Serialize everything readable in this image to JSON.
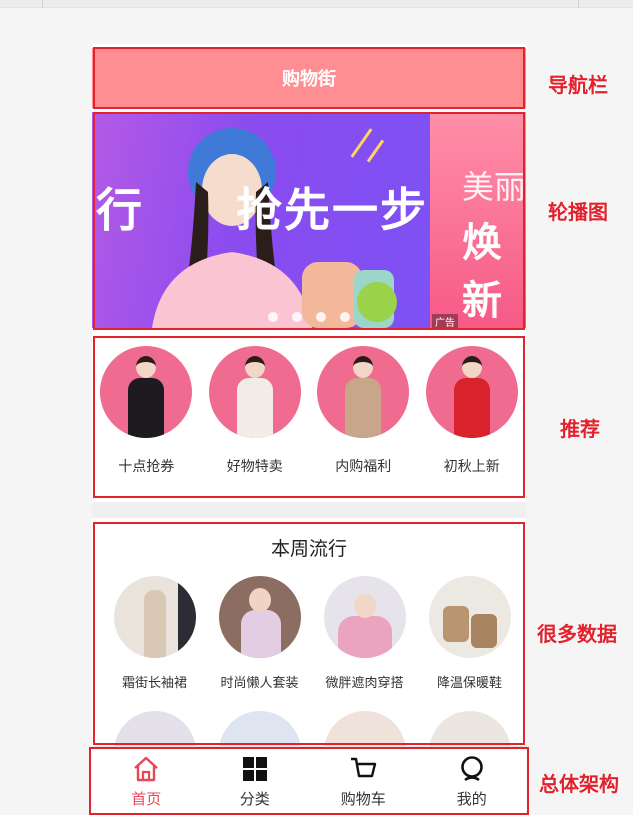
{
  "navbar": {
    "title": "购物街"
  },
  "banner": {
    "slide1_left_text": "行",
    "slide1_right_text": "抢先一步",
    "slide2_line1": "美丽",
    "slide2_line2": "焕新",
    "ad_tag": "广告",
    "dots_count": 4
  },
  "recommend": {
    "items": [
      {
        "label": "十点抢券"
      },
      {
        "label": "好物特卖"
      },
      {
        "label": "内购福利"
      },
      {
        "label": "初秋上新"
      }
    ]
  },
  "weekly": {
    "title": "本周流行",
    "items": [
      {
        "label": "霜街长袖裙"
      },
      {
        "label": "时尚懒人套装"
      },
      {
        "label": "微胖遮肉穿搭"
      },
      {
        "label": "降温保暖鞋"
      }
    ]
  },
  "tabbar": {
    "items": [
      {
        "label": "首页",
        "icon": "home-icon",
        "active": true
      },
      {
        "label": "分类",
        "icon": "grid-icon",
        "active": false
      },
      {
        "label": "购物车",
        "icon": "cart-icon",
        "active": false
      },
      {
        "label": "我的",
        "icon": "profile-icon",
        "active": false
      }
    ]
  },
  "annotations": {
    "navbar": "导航栏",
    "banner": "轮播图",
    "recommend": "推荐",
    "data": "很多数据",
    "architecture": "总体架构"
  },
  "colors": {
    "accent": "#e84855",
    "navbar_bg": "#ff8e92",
    "annotation": "#e0232d"
  }
}
